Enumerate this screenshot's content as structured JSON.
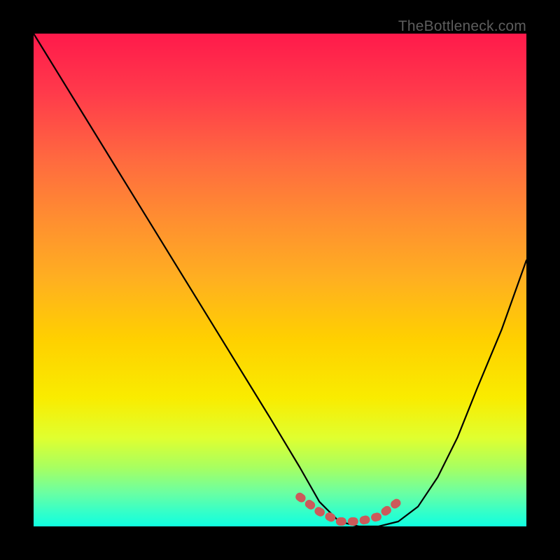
{
  "watermark": "TheBottleneck.com",
  "colors": {
    "frame_bg": "#000000",
    "curve": "#000000",
    "plateau": "#cc5a5a"
  },
  "chart_data": {
    "type": "line",
    "title": "",
    "xlabel": "",
    "ylabel": "",
    "xlim": [
      0,
      100
    ],
    "ylim": [
      0,
      100
    ],
    "grid": false,
    "legend": false,
    "series": [
      {
        "name": "bottleneck-curve",
        "x": [
          0,
          8,
          16,
          24,
          32,
          40,
          48,
          54,
          58,
          62,
          66,
          70,
          74,
          78,
          82,
          86,
          90,
          95,
          100
        ],
        "values": [
          100,
          87,
          74,
          61,
          48,
          35,
          22,
          12,
          5,
          1,
          0,
          0,
          1,
          4,
          10,
          18,
          28,
          40,
          54
        ]
      }
    ],
    "annotations": [
      {
        "name": "optimal-plateau",
        "style": "dashed-highlight",
        "x": [
          54,
          58,
          62,
          66,
          70,
          74
        ],
        "values": [
          6,
          3,
          1,
          1,
          2,
          5
        ]
      }
    ]
  }
}
